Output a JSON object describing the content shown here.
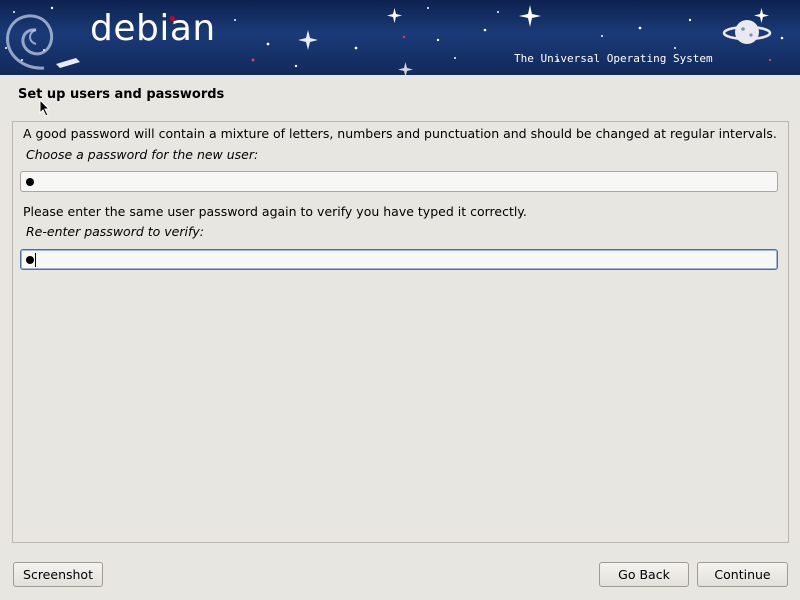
{
  "banner": {
    "logo_text": "debian",
    "tagline": "The Universal Operating System"
  },
  "page": {
    "title": "Set up users and passwords"
  },
  "form": {
    "password_help": "A good password will contain a mixture of letters, numbers and punctuation and should be changed at regular intervals.",
    "password_prompt": "Choose a password for the new user:",
    "password_masked_chars": 1,
    "verify_help": "Please enter the same user password again to verify you have typed it correctly.",
    "verify_prompt": "Re-enter password to verify:",
    "verify_masked_chars": 1
  },
  "buttons": {
    "screenshot": "Screenshot",
    "go_back": "Go Back",
    "continue": "Continue"
  },
  "colors": {
    "banner_bg": "#12295a",
    "window_bg": "#e8e6e0",
    "accent_red": "#d0021b",
    "focus_border": "#4f6f98"
  }
}
